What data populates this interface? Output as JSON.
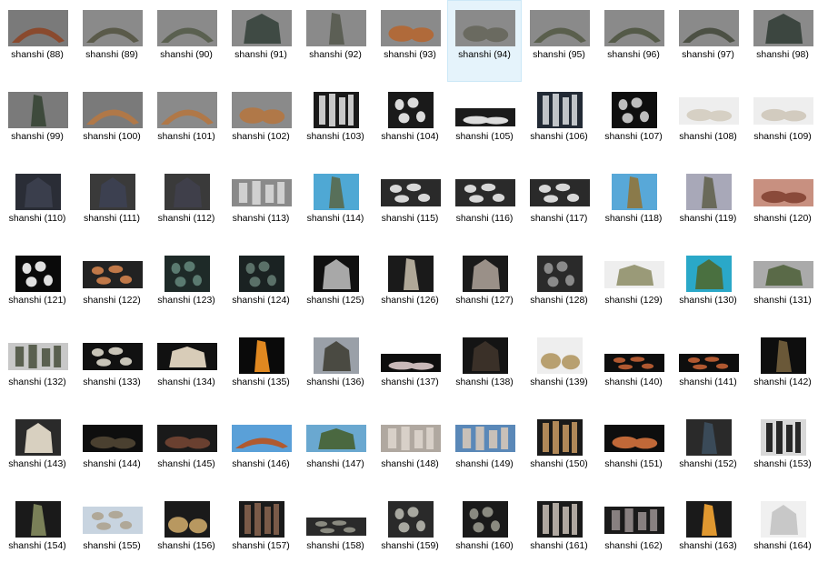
{
  "file_browser": {
    "selected_index": 6,
    "items": [
      {
        "label": "shanshi (88)",
        "bg": "#7a7a7a",
        "rock": "#8a4a2e",
        "shape": "arch",
        "aspect": "wide"
      },
      {
        "label": "shanshi (89)",
        "bg": "#8a8a8a",
        "rock": "#5a5a4a",
        "shape": "arch",
        "aspect": "wide"
      },
      {
        "label": "shanshi (90)",
        "bg": "#8a8a8a",
        "rock": "#5a6050",
        "shape": "arch",
        "aspect": "wide"
      },
      {
        "label": "shanshi (91)",
        "bg": "#8a8a8a",
        "rock": "#3f4a44",
        "shape": "blob",
        "aspect": "wide"
      },
      {
        "label": "shanshi (92)",
        "bg": "#8a8a8a",
        "rock": "#5c5f55",
        "shape": "spire",
        "aspect": "wide"
      },
      {
        "label": "shanshi (93)",
        "bg": "#8a8a8a",
        "rock": "#b06a3a",
        "shape": "flat",
        "aspect": "wide"
      },
      {
        "label": "shanshi (94)",
        "bg": "#8a8a8a",
        "rock": "#6a6a60",
        "shape": "flat",
        "aspect": "wide"
      },
      {
        "label": "shanshi (95)",
        "bg": "#8a8a8a",
        "rock": "#5a5f4d",
        "shape": "arch",
        "aspect": "wide"
      },
      {
        "label": "shanshi (96)",
        "bg": "#8a8a8a",
        "rock": "#545a48",
        "shape": "arch",
        "aspect": "wide"
      },
      {
        "label": "shanshi (97)",
        "bg": "#8a8a8a",
        "rock": "#4c5044",
        "shape": "arch",
        "aspect": "wide"
      },
      {
        "label": "shanshi (98)",
        "bg": "#8a8a8a",
        "rock": "#3c4640",
        "shape": "blob",
        "aspect": "wide"
      },
      {
        "label": "shanshi (99)",
        "bg": "#7a7a7a",
        "rock": "#3e4a3c",
        "shape": "spire",
        "aspect": "wide"
      },
      {
        "label": "shanshi (100)",
        "bg": "#7a7a7a",
        "rock": "#b07848",
        "shape": "arch",
        "aspect": "wide"
      },
      {
        "label": "shanshi (101)",
        "bg": "#8a8a8a",
        "rock": "#b07848",
        "shape": "arch",
        "aspect": "wide"
      },
      {
        "label": "shanshi (102)",
        "bg": "#8a8a8a",
        "rock": "#b07848",
        "shape": "flat",
        "aspect": "wide"
      },
      {
        "label": "shanshi (103)",
        "bg": "#1a1a1a",
        "rock": "#c8c8c8",
        "shape": "columns",
        "aspect": "tall"
      },
      {
        "label": "shanshi (104)",
        "bg": "#1a1a1a",
        "rock": "#dcdcdc",
        "shape": "scatter",
        "aspect": "tall"
      },
      {
        "label": "shanshi (105)",
        "bg": "#1a1a1a",
        "rock": "#dcdcdc",
        "shape": "flat",
        "aspect": "short"
      },
      {
        "label": "shanshi (106)",
        "bg": "#222a35",
        "rock": "#c0c4c8",
        "shape": "columns",
        "aspect": "tall"
      },
      {
        "label": "shanshi (107)",
        "bg": "#0e0e0e",
        "rock": "#bdbdbd",
        "shape": "scatter",
        "aspect": "tall"
      },
      {
        "label": "shanshi (108)",
        "bg": "#eeeeee",
        "rock": "#d6d0c4",
        "shape": "flat",
        "aspect": "mid"
      },
      {
        "label": "shanshi (109)",
        "bg": "#eeeeee",
        "rock": "#d2cbbf",
        "shape": "flat",
        "aspect": "mid"
      },
      {
        "label": "shanshi (110)",
        "bg": "#2a2d36",
        "rock": "#3a3e4c",
        "shape": "blob",
        "aspect": "tall"
      },
      {
        "label": "shanshi (111)",
        "bg": "#3a3a3a",
        "rock": "#3c4050",
        "shape": "blob",
        "aspect": "tall"
      },
      {
        "label": "shanshi (112)",
        "bg": "#3a3a3a",
        "rock": "#3f3f4a",
        "shape": "blob",
        "aspect": "tall"
      },
      {
        "label": "shanshi (113)",
        "bg": "#8a8a8a",
        "rock": "#d0d0d0",
        "shape": "columns",
        "aspect": "mid"
      },
      {
        "label": "shanshi (114)",
        "bg": "#4fa8d4",
        "rock": "#58705a",
        "shape": "spire",
        "aspect": "tall"
      },
      {
        "label": "shanshi (115)",
        "bg": "#2a2a2a",
        "rock": "#d8d8d8",
        "shape": "scatter",
        "aspect": "mid"
      },
      {
        "label": "shanshi (116)",
        "bg": "#2a2a2a",
        "rock": "#d8d8d8",
        "shape": "scatter",
        "aspect": "mid"
      },
      {
        "label": "shanshi (117)",
        "bg": "#2a2a2a",
        "rock": "#d8d8d8",
        "shape": "scatter",
        "aspect": "mid"
      },
      {
        "label": "shanshi (118)",
        "bg": "#58a8d8",
        "rock": "#8a7a4a",
        "shape": "spire",
        "aspect": "tall"
      },
      {
        "label": "shanshi (119)",
        "bg": "#a8a8b8",
        "rock": "#6a6a5a",
        "shape": "spire",
        "aspect": "tall"
      },
      {
        "label": "shanshi (120)",
        "bg": "#c89080",
        "rock": "#8a4a3a",
        "shape": "flat",
        "aspect": "mid"
      },
      {
        "label": "shanshi (121)",
        "bg": "#0a0a0a",
        "rock": "#e0e0e0",
        "shape": "scatter",
        "aspect": "tall"
      },
      {
        "label": "shanshi (122)",
        "bg": "#222222",
        "rock": "#c07848",
        "shape": "scatter",
        "aspect": "mid"
      },
      {
        "label": "shanshi (123)",
        "bg": "#1e2a28",
        "rock": "#5a7a70",
        "shape": "scatter",
        "aspect": "tall"
      },
      {
        "label": "shanshi (124)",
        "bg": "#1a2222",
        "rock": "#5a7068",
        "shape": "scatter",
        "aspect": "tall"
      },
      {
        "label": "shanshi (125)",
        "bg": "#111111",
        "rock": "#a8a8a8",
        "shape": "blob",
        "aspect": "tall"
      },
      {
        "label": "shanshi (126)",
        "bg": "#1a1a1a",
        "rock": "#b0a898",
        "shape": "spire",
        "aspect": "tall"
      },
      {
        "label": "shanshi (127)",
        "bg": "#1a1a1a",
        "rock": "#9a9088",
        "shape": "blob",
        "aspect": "tall"
      },
      {
        "label": "shanshi (128)",
        "bg": "#2a2a2a",
        "rock": "#8a8a8a",
        "shape": "scatter",
        "aspect": "tall"
      },
      {
        "label": "shanshi (129)",
        "bg": "#eeeeee",
        "rock": "#9a9a78",
        "shape": "blob",
        "aspect": "mid"
      },
      {
        "label": "shanshi (130)",
        "bg": "#2aa8c8",
        "rock": "#4a7040",
        "shape": "blob",
        "aspect": "tall"
      },
      {
        "label": "shanshi (131)",
        "bg": "#aaaaaa",
        "rock": "#5a6a48",
        "shape": "blob",
        "aspect": "mid"
      },
      {
        "label": "shanshi (132)",
        "bg": "#c8c8c8",
        "rock": "#5a6050",
        "shape": "columns",
        "aspect": "mid"
      },
      {
        "label": "shanshi (133)",
        "bg": "#111111",
        "rock": "#c8c4b8",
        "shape": "scatter",
        "aspect": "mid"
      },
      {
        "label": "shanshi (134)",
        "bg": "#111111",
        "rock": "#d8ccb8",
        "shape": "blob",
        "aspect": "mid"
      },
      {
        "label": "shanshi (135)",
        "bg": "#0a0a0a",
        "rock": "#e08820",
        "shape": "spire",
        "aspect": "tall"
      },
      {
        "label": "shanshi (136)",
        "bg": "#9aa0a8",
        "rock": "#4a4a42",
        "shape": "blob",
        "aspect": "tall"
      },
      {
        "label": "shanshi (137)",
        "bg": "#0e0e0e",
        "rock": "#c8b8b8",
        "shape": "flat",
        "aspect": "short"
      },
      {
        "label": "shanshi (138)",
        "bg": "#141414",
        "rock": "#3a3028",
        "shape": "blob",
        "aspect": "tall"
      },
      {
        "label": "shanshi (139)",
        "bg": "#eeeeee",
        "rock": "#b8a070",
        "shape": "flat",
        "aspect": "tall"
      },
      {
        "label": "shanshi (140)",
        "bg": "#0e0e0e",
        "rock": "#b05830",
        "shape": "scatter",
        "aspect": "short"
      },
      {
        "label": "shanshi (141)",
        "bg": "#0e0e0e",
        "rock": "#b05830",
        "shape": "scatter",
        "aspect": "short"
      },
      {
        "label": "shanshi (142)",
        "bg": "#0e0e0e",
        "rock": "#6a5838",
        "shape": "spire",
        "aspect": "tall"
      },
      {
        "label": "shanshi (143)",
        "bg": "#2a2a2a",
        "rock": "#d8d0c0",
        "shape": "blob",
        "aspect": "tall"
      },
      {
        "label": "shanshi (144)",
        "bg": "#0e0e0e",
        "rock": "#4a4030",
        "shape": "flat",
        "aspect": "mid"
      },
      {
        "label": "shanshi (145)",
        "bg": "#1a1a1a",
        "rock": "#6a4030",
        "shape": "flat",
        "aspect": "mid"
      },
      {
        "label": "shanshi (146)",
        "bg": "#5aa0d8",
        "rock": "#b05a30",
        "shape": "arch",
        "aspect": "mid"
      },
      {
        "label": "shanshi (147)",
        "bg": "#6aa8d0",
        "rock": "#4a6840",
        "shape": "blob",
        "aspect": "mid"
      },
      {
        "label": "shanshi (148)",
        "bg": "#b0a8a0",
        "rock": "#d8d0c8",
        "shape": "columns",
        "aspect": "mid"
      },
      {
        "label": "shanshi (149)",
        "bg": "#5a88b8",
        "rock": "#c8c0b8",
        "shape": "columns",
        "aspect": "mid"
      },
      {
        "label": "shanshi (150)",
        "bg": "#1a1a1a",
        "rock": "#b08858",
        "shape": "columns",
        "aspect": "tall"
      },
      {
        "label": "shanshi (151)",
        "bg": "#0e0e0e",
        "rock": "#c06838",
        "shape": "flat",
        "aspect": "mid"
      },
      {
        "label": "shanshi (152)",
        "bg": "#2a2a2a",
        "rock": "#3a4a58",
        "shape": "spire",
        "aspect": "tall"
      },
      {
        "label": "shanshi (153)",
        "bg": "#d8d8d8",
        "rock": "#282828",
        "shape": "columns",
        "aspect": "tall"
      },
      {
        "label": "shanshi (154)",
        "bg": "#1a1a1a",
        "rock": "#7a8058",
        "shape": "spire",
        "aspect": "tall"
      },
      {
        "label": "shanshi (155)",
        "bg": "#c8d4e0",
        "rock": "#b0a898",
        "shape": "scatter",
        "aspect": "mid"
      },
      {
        "label": "shanshi (156)",
        "bg": "#1a1a1a",
        "rock": "#b89860",
        "shape": "flat",
        "aspect": "tall"
      },
      {
        "label": "shanshi (157)",
        "bg": "#1a1a1a",
        "rock": "#7a5a48",
        "shape": "columns",
        "aspect": "tall"
      },
      {
        "label": "shanshi (158)",
        "bg": "#2a2a2a",
        "rock": "#8a8a80",
        "shape": "scatter",
        "aspect": "short"
      },
      {
        "label": "shanshi (159)",
        "bg": "#2a2a2a",
        "rock": "#a8a8a0",
        "shape": "scatter",
        "aspect": "tall"
      },
      {
        "label": "shanshi (160)",
        "bg": "#1a1a1a",
        "rock": "#8a8a80",
        "shape": "scatter",
        "aspect": "tall"
      },
      {
        "label": "shanshi (161)",
        "bg": "#1a1a1a",
        "rock": "#b0a8a0",
        "shape": "columns",
        "aspect": "tall"
      },
      {
        "label": "shanshi (162)",
        "bg": "#1a1a1a",
        "rock": "#888080",
        "shape": "columns",
        "aspect": "mid"
      },
      {
        "label": "shanshi (163)",
        "bg": "#1a1a1a",
        "rock": "#e09830",
        "shape": "spire",
        "aspect": "tall"
      },
      {
        "label": "shanshi (164)",
        "bg": "#f0f0f0",
        "rock": "#c8c8c8",
        "shape": "blob",
        "aspect": "tall"
      }
    ]
  }
}
